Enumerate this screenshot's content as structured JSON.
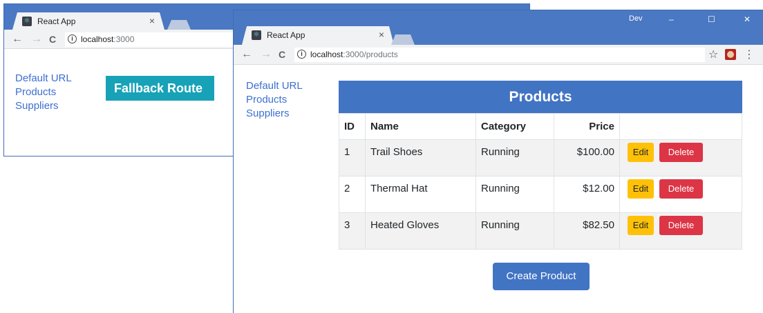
{
  "window_back": {
    "tab_title": "React App",
    "tab_close": "×",
    "url_host": "localhost",
    "url_rest": ":3000",
    "nav_links": [
      "Default URL",
      "Products",
      "Suppliers"
    ],
    "fallback_text": "Fallback Route"
  },
  "window_front": {
    "tab_title": "React App",
    "tab_close": "×",
    "profile_label": "Dev",
    "minimize": "–",
    "maximize": "☐",
    "close": "✕",
    "url_host": "localhost",
    "url_rest": ":3000/products",
    "nav_links": [
      "Default URL",
      "Products",
      "Suppliers"
    ],
    "products_title": "Products",
    "columns": [
      "ID",
      "Name",
      "Category",
      "Price"
    ],
    "rows": [
      {
        "id": "1",
        "name": "Trail Shoes",
        "category": "Running",
        "price": "$100.00"
      },
      {
        "id": "2",
        "name": "Thermal Hat",
        "category": "Running",
        "price": "$12.00"
      },
      {
        "id": "3",
        "name": "Heated Gloves",
        "category": "Running",
        "price": "$82.50"
      }
    ],
    "edit_label": "Edit",
    "delete_label": "Delete",
    "create_label": "Create Product"
  },
  "icons": {
    "back": "←",
    "forward": "→",
    "reload": "C",
    "info": "i",
    "star": "☆",
    "menu": "⋮",
    "react": "⚛"
  },
  "colors": {
    "title_bar": "#4a78c2",
    "primary": "#4274c4",
    "fallback": "#17a2b8",
    "edit": "#ffc107",
    "delete": "#dc3545",
    "link": "#3d6fd1"
  }
}
